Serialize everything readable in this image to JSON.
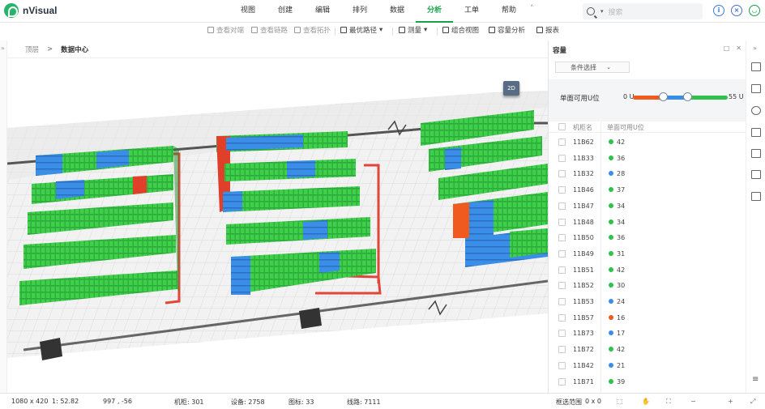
{
  "app": {
    "name": "nVisual"
  },
  "menu": {
    "items": [
      "视图",
      "创建",
      "编辑",
      "排列",
      "数据",
      "分析",
      "工单",
      "帮助"
    ],
    "active": 5,
    "collapse_glyph": "˄"
  },
  "search": {
    "placeholder": "搜索",
    "dropdown_glyph": "▾"
  },
  "header_icons": [
    "info-icon",
    "settings-circle-icon",
    "user-icon"
  ],
  "toolbar": {
    "items": [
      {
        "label": "查看对端",
        "enabled": false
      },
      {
        "label": "查看链路",
        "enabled": false
      },
      {
        "label": "查看拓扑",
        "enabled": false
      },
      {
        "label": "最优路径",
        "enabled": true,
        "dropdown": true
      },
      {
        "label": "测量",
        "enabled": true,
        "dropdown": true
      },
      {
        "label": "组合视图",
        "enabled": true
      },
      {
        "label": "容量分析",
        "enabled": true
      },
      {
        "label": "报表",
        "enabled": true
      }
    ]
  },
  "breadcrumb": {
    "root": "顶层",
    "separator": ">",
    "current": "数据中心"
  },
  "scene": {
    "view_toggle": "2D"
  },
  "panel": {
    "title": "容量",
    "condition_select": "条件选择",
    "slider": {
      "label": "单面可用U位",
      "min_label": "0 U",
      "max_label": "55 U",
      "low_fraction": 0.32,
      "high_fraction": 0.57
    },
    "columns": [
      "机柜名",
      "单面可用U位"
    ],
    "rows": [
      {
        "name": "11B62",
        "value": "42",
        "color": "#2ec24a"
      },
      {
        "name": "11B33",
        "value": "36",
        "color": "#2ec24a"
      },
      {
        "name": "11B32",
        "value": "28",
        "color": "#3b8ee8"
      },
      {
        "name": "11B46",
        "value": "37",
        "color": "#2ec24a"
      },
      {
        "name": "11B47",
        "value": "34",
        "color": "#2ec24a"
      },
      {
        "name": "11B48",
        "value": "34",
        "color": "#2ec24a"
      },
      {
        "name": "11B50",
        "value": "36",
        "color": "#2ec24a"
      },
      {
        "name": "11B49",
        "value": "31",
        "color": "#2ec24a"
      },
      {
        "name": "11B51",
        "value": "42",
        "color": "#2ec24a"
      },
      {
        "name": "11B52",
        "value": "30",
        "color": "#2ec24a"
      },
      {
        "name": "11B53",
        "value": "24",
        "color": "#3b8ee8"
      },
      {
        "name": "11B57",
        "value": "16",
        "color": "#f05a1e"
      },
      {
        "name": "11B73",
        "value": "17",
        "color": "#3b8ee8"
      },
      {
        "name": "11B72",
        "value": "42",
        "color": "#2ec24a"
      },
      {
        "name": "11B42",
        "value": "21",
        "color": "#3b8ee8"
      },
      {
        "name": "11B71",
        "value": "39",
        "color": "#2ec24a"
      }
    ]
  },
  "colors": {
    "accent": "#17a34a",
    "high": "#2ec24a",
    "mid": "#3b8ee8",
    "low": "#f05a1e"
  },
  "status": {
    "resolution": "1080 x 420",
    "scale": "1: 52.82",
    "coords": "997 , -56",
    "cabinets": "机柜: 301",
    "devices": "设备: 2758",
    "icons": "图标: 33",
    "lines": "线路: 7111",
    "selection": "框选范围",
    "selection_value": "0 x 0"
  }
}
